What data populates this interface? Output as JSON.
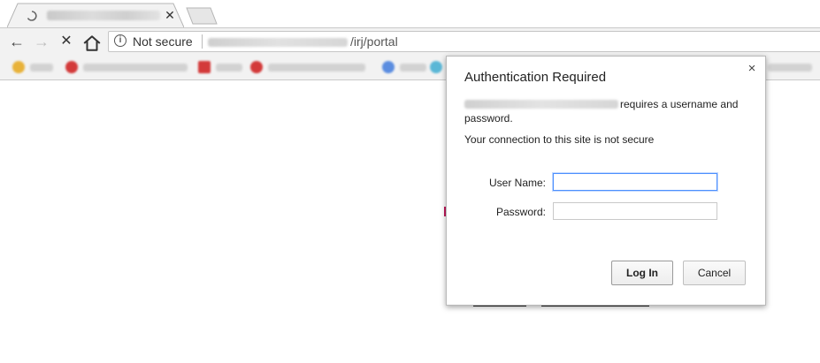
{
  "tab": {
    "close_glyph": "✕",
    "loading_icon": "spinner-icon"
  },
  "nav": {
    "back_glyph": "←",
    "forward_glyph": "→",
    "stop_glyph": "✕",
    "home_icon": "home-icon"
  },
  "omnibox": {
    "info_glyph": "i",
    "security_label": "Not secure",
    "url_path": "/irj/portal"
  },
  "colors": {
    "focus_ring": "#4d90fe",
    "bookmark_red": "#d33a3a",
    "bookmark_blue": "#5b8de0"
  },
  "dialog": {
    "title": "Authentication Required",
    "close_glyph": "×",
    "requires_text": "requires a username and password.",
    "not_secure_text": "Your connection to this site is not secure",
    "username_label": "User Name:",
    "username_value": "",
    "password_label": "Password:",
    "password_value": "",
    "login_label": "Log In",
    "cancel_label": "Cancel"
  }
}
